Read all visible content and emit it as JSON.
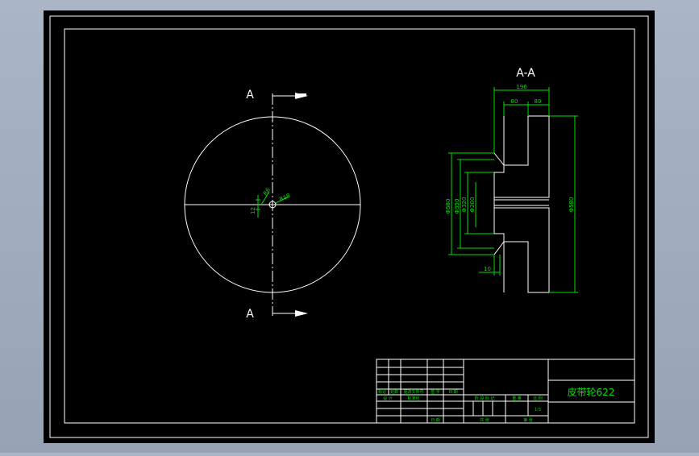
{
  "section_view": {
    "title": "A-A",
    "dims": {
      "overall_width": "196",
      "hub_width": "80",
      "rim_width": "80",
      "outer_dia": "Φ580",
      "hub_outer_dia": "Φ350",
      "hub_mid_dia": "Φ320",
      "bore_dia": "Φ200",
      "bore_right_dia": "Φ580",
      "groove_depth": "10"
    }
  },
  "front_view": {
    "cut_label_top": "A",
    "cut_label_bottom": "A",
    "dims": {
      "keyway_width": "R6",
      "keyway_depth": "12",
      "bore_label": "R18"
    }
  },
  "title_block": {
    "drawing_name": "皮带轮622",
    "row_labels": [
      "标记",
      "处数",
      "更改文件号",
      "签 字",
      "日 期"
    ],
    "label_design": "设 计",
    "label_std": "标准化",
    "label_stage": "阶 段 标 记",
    "label_weight": "重 量",
    "label_scale": "比 例",
    "scale_value": "1:5",
    "label_check": "审 核",
    "label_process": "工 艺",
    "label_approve": "批 准",
    "label_sheets": "共  张",
    "label_sheet": "第  张"
  },
  "colors": {
    "background": "#000000",
    "outline": "#ffffff",
    "dimension": "#00e000",
    "window": "#a9b4c4"
  }
}
